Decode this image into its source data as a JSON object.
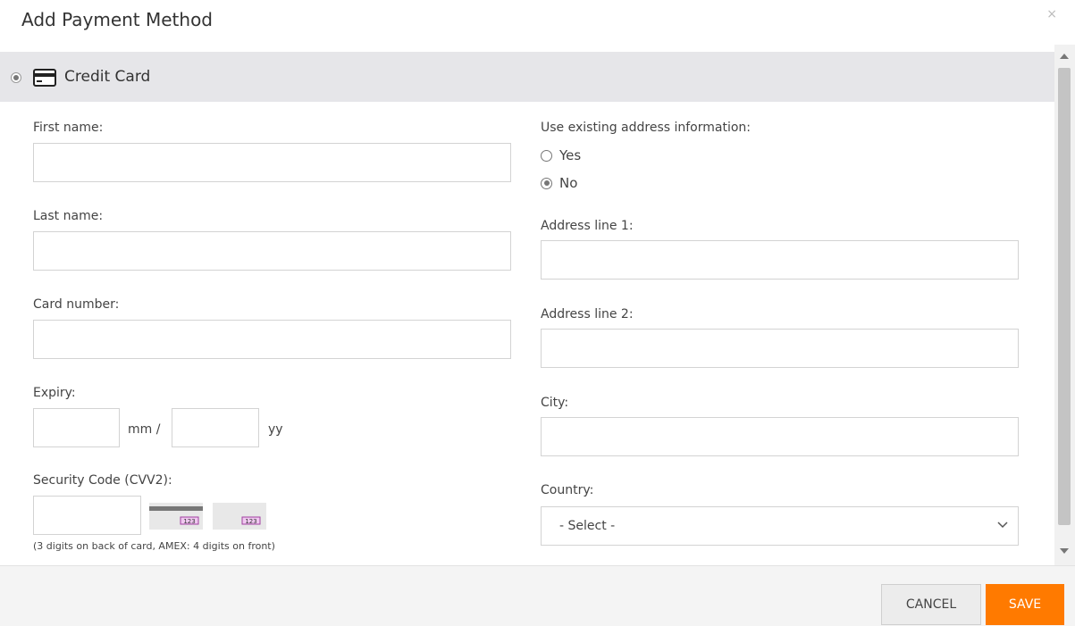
{
  "modal": {
    "title": "Add Payment Method",
    "close_symbol": "×"
  },
  "payment_method": {
    "label": "Credit Card",
    "selected": true,
    "icon": "credit-card-icon"
  },
  "form_left": {
    "first_name_label": "First name:",
    "first_name_value": "",
    "last_name_label": "Last name:",
    "last_name_value": "",
    "card_number_label": "Card number:",
    "card_number_value": "",
    "expiry_label": "Expiry:",
    "expiry_mm_unit": "mm /",
    "expiry_yy_unit": "yy",
    "security_code_label": "Security Code (CVV2):",
    "security_code_hint": "(3 digits on back of card, AMEX: 4 digits on front)"
  },
  "form_right": {
    "use_existing_label": "Use existing address information:",
    "option_yes": "Yes",
    "option_no": "No",
    "selected_option": "No",
    "address1_label": "Address line 1:",
    "address2_label": "Address line 2:",
    "city_label": "City:",
    "country_label": "Country:",
    "country_selected": "- Select -"
  },
  "footer": {
    "cancel_label": "CANCEL",
    "save_label": "SAVE"
  },
  "colors": {
    "save_button": "#ff7a00",
    "method_bar": "#e6e6e9"
  }
}
